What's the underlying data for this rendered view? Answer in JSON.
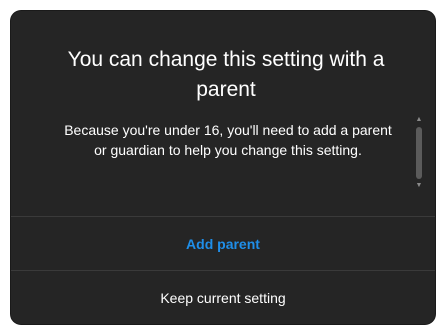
{
  "dialog": {
    "title": "You can change this setting with a parent",
    "message": "Because you're under 16, you'll need to add a parent or guardian to help you change this setting.",
    "primary_action": "Add parent",
    "secondary_action": "Keep current setting"
  },
  "scrollbar": {
    "up_icon": "▲",
    "down_icon": "▼"
  },
  "colors": {
    "dialog_background": "#252525",
    "accent": "#1f8ee8",
    "text": "#ffffff"
  }
}
